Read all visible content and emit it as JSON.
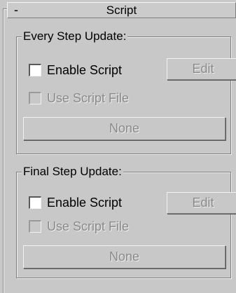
{
  "rollout": {
    "collapse_symbol": "-",
    "title": "Script"
  },
  "groups": [
    {
      "title": "Every Step Update:",
      "enable_script_label": "Enable Script",
      "enable_script_checked": false,
      "edit_label": "Edit",
      "use_script_file_label": "Use Script File",
      "use_script_file_checked": false,
      "file_button_label": "None"
    },
    {
      "title": "Final Step Update:",
      "enable_script_label": "Enable Script",
      "enable_script_checked": false,
      "edit_label": "Edit",
      "use_script_file_label": "Use Script File",
      "use_script_file_checked": false,
      "file_button_label": "None"
    }
  ]
}
